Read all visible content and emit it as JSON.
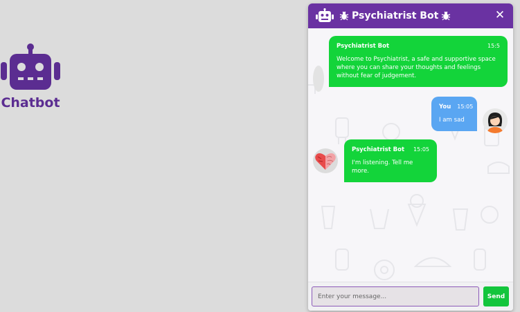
{
  "launcher": {
    "label": "Chatbot",
    "icon": "robot-icon",
    "color": "#5b2d91"
  },
  "chat": {
    "header": {
      "title": "Psychiatrist Bot",
      "background": "#6a32a2",
      "left_icon": "robot-icon",
      "title_icons": [
        "bug-icon",
        "bug-icon"
      ],
      "close_icon": "close-icon",
      "close_glyph": "✕"
    },
    "messages": [
      {
        "sender": "Psychiatrist Bot",
        "time": "15:5",
        "text": "Welcome to Psychiatrist, a safe and supportive space where you can share your thoughts and feelings without fear of judgement.",
        "side": "bot"
      },
      {
        "sender": "You",
        "time": "15:05",
        "text": "I am sad",
        "side": "user"
      },
      {
        "sender": "Psychiatrist Bot",
        "time": "15:05",
        "text": "I'm listening. Tell me more.",
        "side": "bot"
      }
    ],
    "footer": {
      "input_value": "",
      "input_placeholder": "Enter your message...",
      "send_label": "Send"
    },
    "colors": {
      "bot_bubble": "#13d43a",
      "user_bubble": "#5aa6f2",
      "send_button": "#13c53c"
    }
  }
}
